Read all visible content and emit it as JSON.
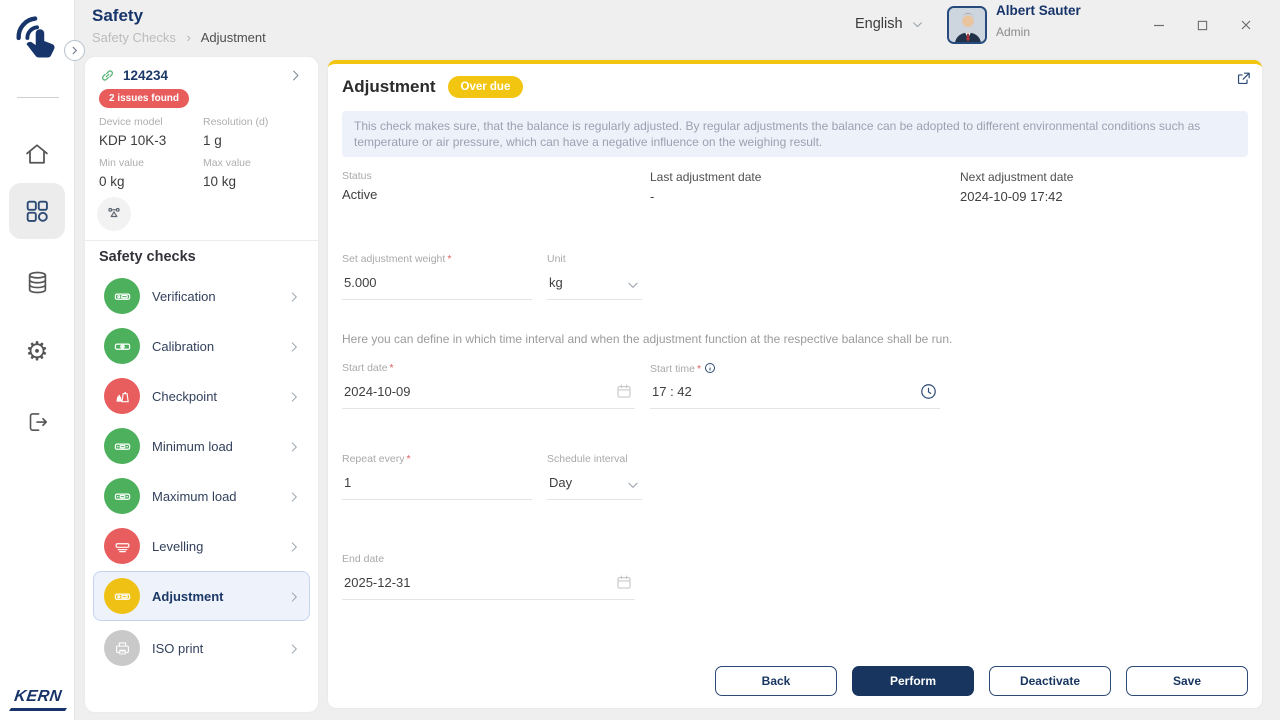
{
  "header": {
    "title": "Safety",
    "breadcrumb": {
      "parent": "Safety Checks",
      "separator": "›",
      "current": "Adjustment"
    },
    "language": "English",
    "user": {
      "name": "Albert Sauter",
      "role": "Admin"
    },
    "window_controls": {
      "minimize": "–",
      "maximize": "▢",
      "close": "✕"
    }
  },
  "sidebar": {
    "brand": "KERN",
    "items": [
      {
        "name": "home",
        "icon": "home-icon",
        "active": false
      },
      {
        "name": "dashboard",
        "icon": "apps-grid-icon",
        "active": true
      },
      {
        "name": "database",
        "icon": "database-icon",
        "active": false
      },
      {
        "name": "settings",
        "icon": "gear-icon",
        "active": false
      },
      {
        "name": "logout",
        "icon": "logout-icon",
        "active": false
      }
    ]
  },
  "device": {
    "id": "124234",
    "issues_badge": "2 issues found",
    "fields": [
      {
        "label": "Device model",
        "value": "KDP 10K-3"
      },
      {
        "label": "Resolution (d)",
        "value": "1 g"
      },
      {
        "label": "Min value",
        "value": "0 kg"
      },
      {
        "label": "Max value",
        "value": "10 kg"
      }
    ]
  },
  "checks": {
    "heading": "Safety checks",
    "items": [
      {
        "label": "Verification",
        "status_color": "#4cb05c",
        "selected": false
      },
      {
        "label": "Calibration",
        "status_color": "#4cb05c",
        "selected": false
      },
      {
        "label": "Checkpoint",
        "status_color": "#e85d5d",
        "selected": false
      },
      {
        "label": "Minimum load",
        "status_color": "#4cb05c",
        "selected": false
      },
      {
        "label": "Maximum load",
        "status_color": "#4cb05c",
        "selected": false
      },
      {
        "label": "Levelling",
        "status_color": "#e85d5d",
        "selected": false
      },
      {
        "label": "Adjustment",
        "status_color": "#f0c115",
        "selected": true
      },
      {
        "label": "ISO print",
        "status_color": "#c9c9c9",
        "selected": false
      }
    ]
  },
  "main": {
    "title": "Adjustment",
    "badge": "Over due",
    "info_text": "This check makes sure, that the balance is regularly adjusted. By regular adjustments the balance can be adopted to different environmental conditions such as temperature or air pressure, which can have a negative influence on the weighing result.",
    "status": {
      "label": "Status",
      "value": "Active"
    },
    "last_adjustment": {
      "label": "Last adjustment date",
      "value": "-"
    },
    "next_adjustment": {
      "label": "Next adjustment date",
      "value": "2024-10-09 17:42"
    },
    "form": {
      "weight": {
        "label": "Set adjustment weight",
        "value": "5.000"
      },
      "unit": {
        "label": "Unit",
        "value": "kg"
      },
      "hint": "Here you can define in which time interval and when the adjustment function at the respective balance shall be run.",
      "start_date": {
        "label": "Start date",
        "value": "2024-10-09"
      },
      "start_time": {
        "label": "Start time",
        "value": "17 : 42"
      },
      "repeat": {
        "label": "Repeat every",
        "value": "1"
      },
      "interval": {
        "label": "Schedule interval",
        "value": "Day"
      },
      "end_date": {
        "label": "End date",
        "value": "2025-12-31"
      }
    },
    "buttons": [
      "Back",
      "Perform",
      "Deactivate",
      "Save"
    ]
  },
  "colors": {
    "brand_navy": "#17356a",
    "accent_yellow": "#f2c511",
    "error_red": "#e85c5c",
    "ok_green": "#4cb05c",
    "info_bg": "#edf1f9",
    "selected_bg": "#eef2fb",
    "page_bg": "#efefef"
  }
}
